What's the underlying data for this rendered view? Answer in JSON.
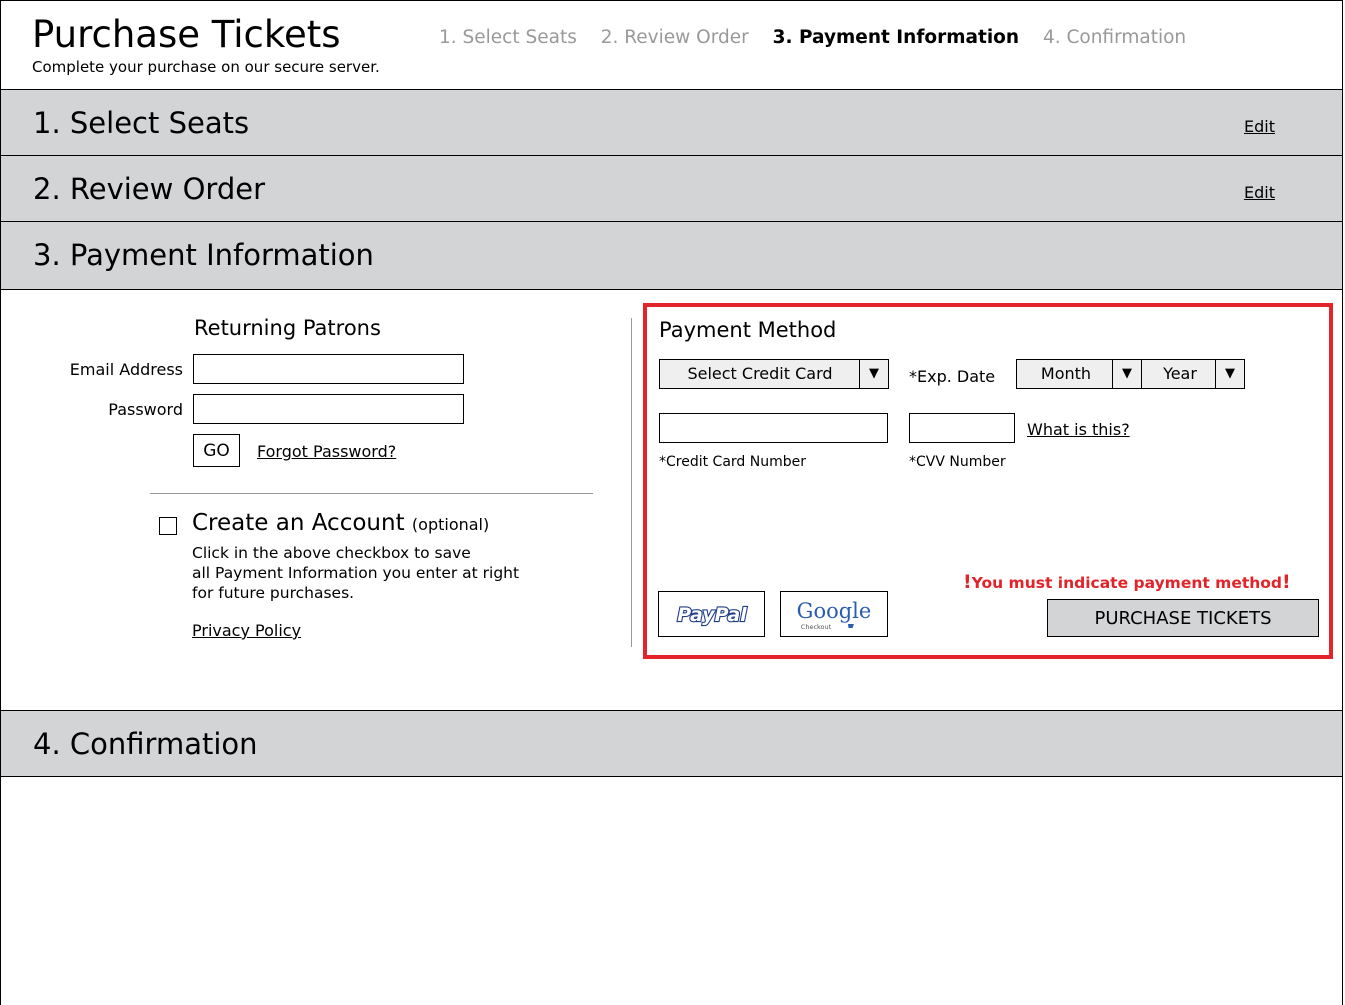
{
  "header": {
    "title": "Purchase Tickets",
    "subtitle": "Complete your purchase on our secure server.",
    "steps": [
      "1. Select Seats",
      "2. Review Order",
      "3. Payment Information",
      "4. Confirmation"
    ],
    "current_step": 3
  },
  "sections": {
    "select_seats": {
      "title": "1. Select Seats",
      "edit_label": "Edit"
    },
    "review_order": {
      "title": "2. Review Order",
      "edit_label": "Edit"
    },
    "payment_information": {
      "title": "3. Payment Information"
    },
    "confirmation": {
      "title": "4. Confirmation"
    }
  },
  "returning_patrons": {
    "title": "Returning Patrons",
    "email_label": "Email Address",
    "email_value": "",
    "password_label": "Password",
    "password_value": "",
    "go_label": "GO",
    "forgot_label": "Forgot Password?"
  },
  "create_account": {
    "title": "Create an Account",
    "optional": "(optional)",
    "checked": false,
    "description": [
      "Click in the above checkbox to save",
      "all Payment Information you enter at right",
      "for future purchases."
    ],
    "privacy_label": "Privacy Policy"
  },
  "payment_method": {
    "title": "Payment Method",
    "card_select": "Select Credit Card",
    "exp_label": "*Exp. Date",
    "month_select": "Month",
    "year_select": "Year",
    "card_number_value": "",
    "card_number_caption": "*Credit Card Number",
    "cvv_value": "",
    "cvv_caption": "*CVV Number",
    "what_is_this": "What is this?",
    "error_bang": "!",
    "error_text": "You must indicate payment method",
    "paypal_logo": "PayPal",
    "google_logo": "Google",
    "google_sub": "Checkout",
    "purchase_label": "PURCHASE TICKETS"
  },
  "colors": {
    "accent_red": "#e2232a",
    "bar_gray": "#d3d4d6",
    "step_inactive": "#999999",
    "paypal_blue": "#1f3c87",
    "paypal_light": "#3f8fd0"
  },
  "icons": {
    "dropdown_arrow": "triangle-down-icon"
  }
}
